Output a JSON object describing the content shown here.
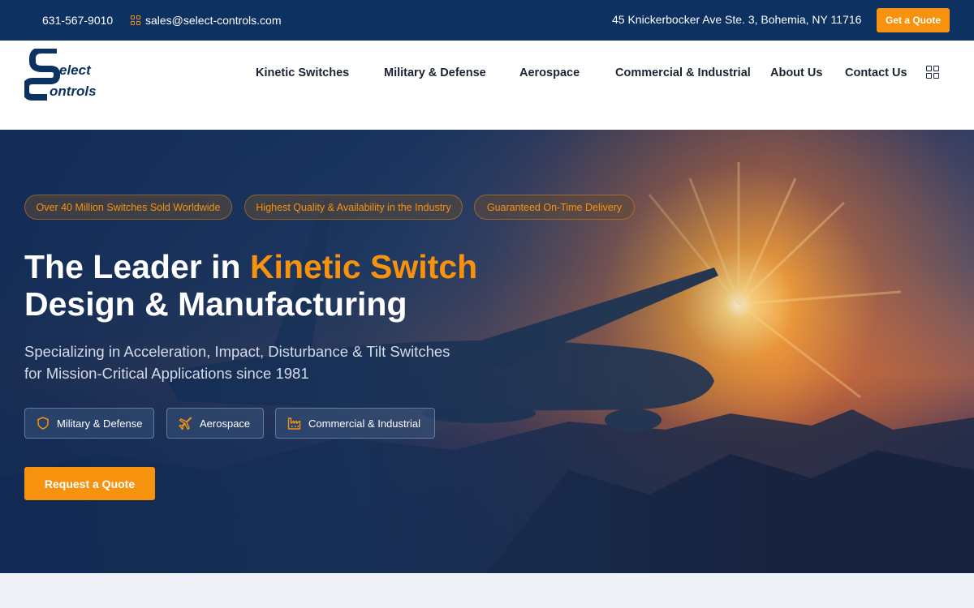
{
  "topbar": {
    "phone": "631-567-9010",
    "email": "sales@select-controls.com",
    "address": "45 Knickerbocker Ave Ste. 3, Bohemia, NY 11716",
    "quote_button": "Get a Quote"
  },
  "logo": {
    "line1": "elect",
    "line2": "ontrols"
  },
  "nav": {
    "items": [
      {
        "label": "Kinetic Switches"
      },
      {
        "label": "Military & Defense"
      },
      {
        "label": "Aerospace"
      },
      {
        "label": "Commercial & Industrial"
      },
      {
        "label": "About Us"
      },
      {
        "label": "Contact Us"
      }
    ],
    "menu_icon": "grid-icon"
  },
  "hero": {
    "pills": [
      {
        "label": "Over 40 Million Switches Sold Worldwide"
      },
      {
        "label": "Highest Quality & Availability in the Industry"
      },
      {
        "label": "Guaranteed On-Time Delivery"
      }
    ],
    "title_prefix": "The Leader in ",
    "title_accent": "Kinetic Switch",
    "title_line2": "Design & Manufacturing",
    "subtitle_line1": "Specializing in Acceleration, Impact, Disturbance & Tilt Switches",
    "subtitle_line2": "for Mission-Critical Applications since 1981",
    "categories": [
      {
        "label": "Military & Defense",
        "icon": "shield-icon"
      },
      {
        "label": "Aerospace",
        "icon": "airplane-icon"
      },
      {
        "label": "Commercial & Industrial",
        "icon": "factory-icon"
      }
    ],
    "cta": "Request a Quote"
  },
  "colors": {
    "navy": "#0d3160",
    "accent": "#f7920f",
    "white": "#ffffff",
    "light_bg": "#eef1f6"
  }
}
